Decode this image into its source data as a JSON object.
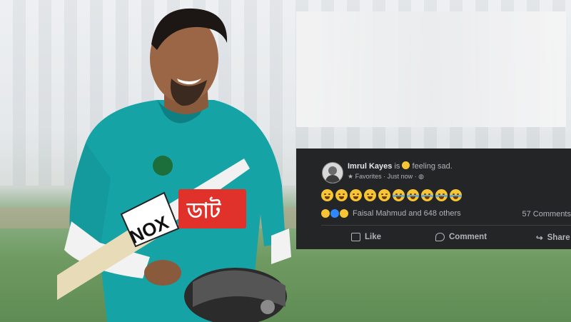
{
  "post": {
    "author": "Imrul Kayes",
    "is_text": "is",
    "feeling_text": "feeling sad.",
    "audience": "Favorites · Just now ·",
    "reactions_text": "Faisal Mahmud and 648 others",
    "comments_text": "57 Comments",
    "actions": {
      "like": "Like",
      "comment": "Comment",
      "share": "Share"
    }
  },
  "photo": {
    "jersey_text": "NOX",
    "sponsor_text": "ডাট"
  },
  "colors": {
    "fb_background": "#242526",
    "text_primary": "#e4e6eb",
    "text_secondary": "#b0b3b8",
    "jersey_teal": "#16a3a6",
    "emoji_yellow": "#f7c533"
  }
}
